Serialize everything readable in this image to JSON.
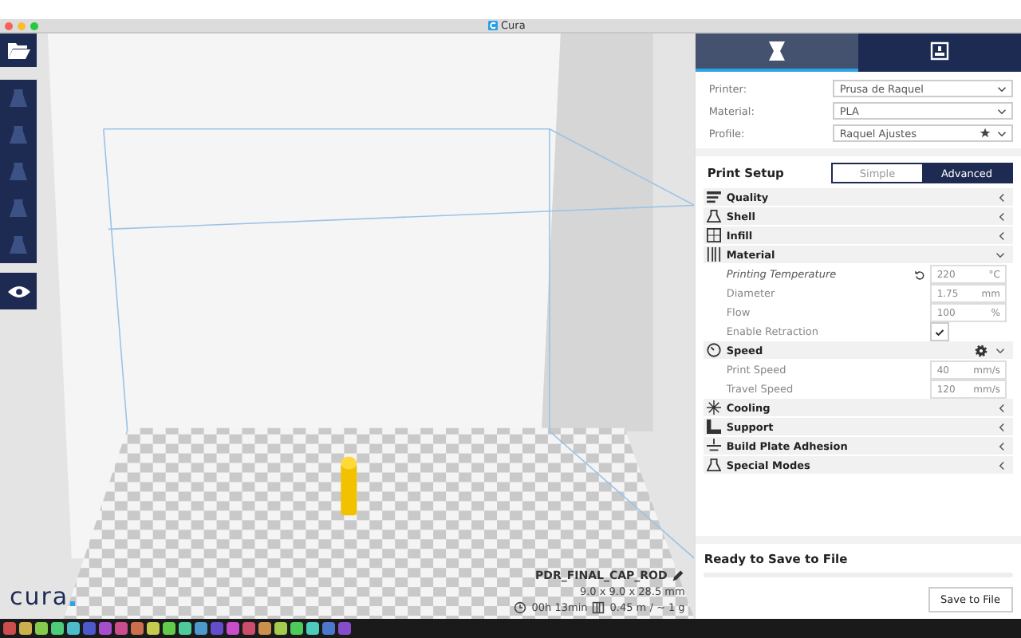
{
  "window": {
    "title": "Cura"
  },
  "toolbar": [
    {
      "kind": "open",
      "disabled": false
    },
    {
      "kind": "move",
      "disabled": true
    },
    {
      "kind": "scale",
      "disabled": true
    },
    {
      "kind": "rotate",
      "disabled": true
    },
    {
      "kind": "mirror",
      "disabled": true
    },
    {
      "kind": "per_model",
      "disabled": true
    },
    {
      "kind": "view",
      "disabled": false
    }
  ],
  "header_tabs": [
    {
      "kind": "prepare",
      "selected": true
    },
    {
      "kind": "monitor",
      "selected": false
    }
  ],
  "machine": [
    {
      "label": "Printer:",
      "value": "Prusa de Raquel",
      "starred": false
    },
    {
      "label": "Material:",
      "value": "PLA",
      "starred": false
    },
    {
      "label": "Profile:",
      "value": "Raquel Ajustes",
      "starred": true
    }
  ],
  "print_setup": {
    "title": "Print Setup",
    "modes": [
      {
        "label": "Simple",
        "selected": false
      },
      {
        "label": "Advanced",
        "selected": true
      }
    ]
  },
  "sections": [
    {
      "kind": "quality",
      "label": "Quality",
      "expanded": false,
      "gear": false
    },
    {
      "kind": "shell",
      "label": "Shell",
      "expanded": false,
      "gear": false
    },
    {
      "kind": "infill",
      "label": "Infill",
      "expanded": false,
      "gear": false
    },
    {
      "kind": "material",
      "label": "Material",
      "expanded": true,
      "gear": false,
      "settings": [
        {
          "kind": "field",
          "label": "Printing Temperature",
          "modified": true,
          "value": "220",
          "unit": "°C"
        },
        {
          "kind": "field",
          "label": "Diameter",
          "modified": false,
          "value": "1.75",
          "unit": "mm"
        },
        {
          "kind": "field",
          "label": "Flow",
          "modified": false,
          "value": "100",
          "unit": "%"
        },
        {
          "kind": "checkbox",
          "label": "Enable Retraction",
          "modified": false,
          "checked": true
        }
      ]
    },
    {
      "kind": "speed",
      "label": "Speed",
      "expanded": true,
      "gear": true,
      "settings": [
        {
          "kind": "field",
          "label": "Print Speed",
          "modified": false,
          "value": "40",
          "unit": "mm/s"
        },
        {
          "kind": "field",
          "label": "Travel Speed",
          "modified": false,
          "value": "120",
          "unit": "mm/s"
        }
      ]
    },
    {
      "kind": "cooling",
      "label": "Cooling",
      "expanded": false,
      "gear": false
    },
    {
      "kind": "support",
      "label": "Support",
      "expanded": false,
      "gear": false
    },
    {
      "kind": "adhesion",
      "label": "Build Plate Adhesion",
      "expanded": false,
      "gear": false
    },
    {
      "kind": "special",
      "label": "Special Modes",
      "expanded": false,
      "gear": false
    }
  ],
  "model": {
    "name": "PDR_FINAL_CAP_ROD",
    "dimensions": "9.0 x 9.0 x 28.5 mm",
    "time": "00h 13min",
    "usage": "0.45 m / ~ 1 g"
  },
  "logo": {
    "text": "cura"
  },
  "output": {
    "status": "Ready to Save to File",
    "level": 0,
    "button": "Save to File"
  }
}
